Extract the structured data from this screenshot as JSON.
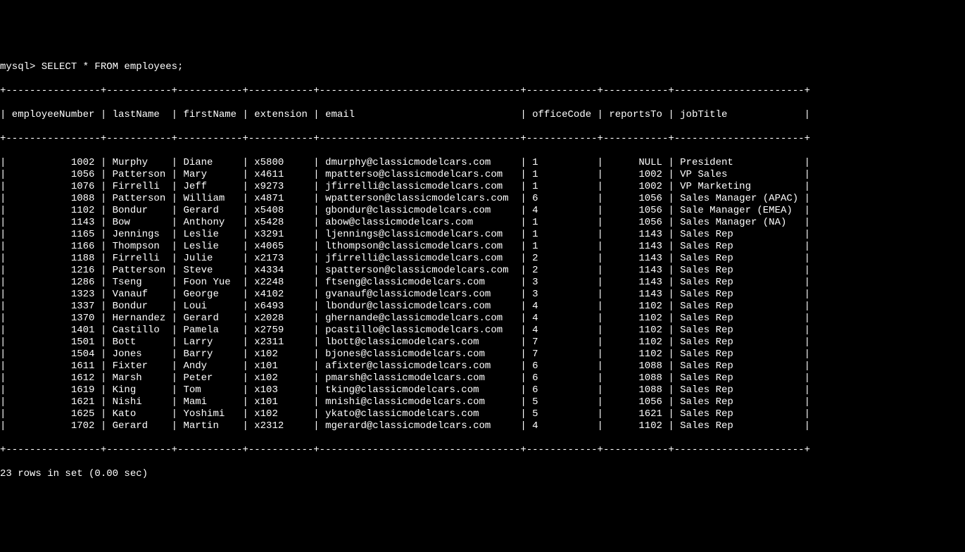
{
  "prompt": "mysql> SELECT * FROM employees;",
  "columns": [
    "employeeNumber",
    "lastName",
    "firstName",
    "extension",
    "email",
    "officeCode",
    "reportsTo",
    "jobTitle"
  ],
  "widths": [
    16,
    11,
    11,
    11,
    34,
    12,
    11,
    22
  ],
  "rightAlign": [
    true,
    false,
    false,
    false,
    false,
    false,
    true,
    false
  ],
  "rows": [
    [
      "1002",
      "Murphy",
      "Diane",
      "x5800",
      "dmurphy@classicmodelcars.com",
      "1",
      "NULL",
      "President"
    ],
    [
      "1056",
      "Patterson",
      "Mary",
      "x4611",
      "mpatterso@classicmodelcars.com",
      "1",
      "1002",
      "VP Sales"
    ],
    [
      "1076",
      "Firrelli",
      "Jeff",
      "x9273",
      "jfirrelli@classicmodelcars.com",
      "1",
      "1002",
      "VP Marketing"
    ],
    [
      "1088",
      "Patterson",
      "William",
      "x4871",
      "wpatterson@classicmodelcars.com",
      "6",
      "1056",
      "Sales Manager (APAC)"
    ],
    [
      "1102",
      "Bondur",
      "Gerard",
      "x5408",
      "gbondur@classicmodelcars.com",
      "4",
      "1056",
      "Sale Manager (EMEA)"
    ],
    [
      "1143",
      "Bow",
      "Anthony",
      "x5428",
      "abow@classicmodelcars.com",
      "1",
      "1056",
      "Sales Manager (NA)"
    ],
    [
      "1165",
      "Jennings",
      "Leslie",
      "x3291",
      "ljennings@classicmodelcars.com",
      "1",
      "1143",
      "Sales Rep"
    ],
    [
      "1166",
      "Thompson",
      "Leslie",
      "x4065",
      "lthompson@classicmodelcars.com",
      "1",
      "1143",
      "Sales Rep"
    ],
    [
      "1188",
      "Firrelli",
      "Julie",
      "x2173",
      "jfirrelli@classicmodelcars.com",
      "2",
      "1143",
      "Sales Rep"
    ],
    [
      "1216",
      "Patterson",
      "Steve",
      "x4334",
      "spatterson@classicmodelcars.com",
      "2",
      "1143",
      "Sales Rep"
    ],
    [
      "1286",
      "Tseng",
      "Foon Yue",
      "x2248",
      "ftseng@classicmodelcars.com",
      "3",
      "1143",
      "Sales Rep"
    ],
    [
      "1323",
      "Vanauf",
      "George",
      "x4102",
      "gvanauf@classicmodelcars.com",
      "3",
      "1143",
      "Sales Rep"
    ],
    [
      "1337",
      "Bondur",
      "Loui",
      "x6493",
      "lbondur@classicmodelcars.com",
      "4",
      "1102",
      "Sales Rep"
    ],
    [
      "1370",
      "Hernandez",
      "Gerard",
      "x2028",
      "ghernande@classicmodelcars.com",
      "4",
      "1102",
      "Sales Rep"
    ],
    [
      "1401",
      "Castillo",
      "Pamela",
      "x2759",
      "pcastillo@classicmodelcars.com",
      "4",
      "1102",
      "Sales Rep"
    ],
    [
      "1501",
      "Bott",
      "Larry",
      "x2311",
      "lbott@classicmodelcars.com",
      "7",
      "1102",
      "Sales Rep"
    ],
    [
      "1504",
      "Jones",
      "Barry",
      "x102",
      "bjones@classicmodelcars.com",
      "7",
      "1102",
      "Sales Rep"
    ],
    [
      "1611",
      "Fixter",
      "Andy",
      "x101",
      "afixter@classicmodelcars.com",
      "6",
      "1088",
      "Sales Rep"
    ],
    [
      "1612",
      "Marsh",
      "Peter",
      "x102",
      "pmarsh@classicmodelcars.com",
      "6",
      "1088",
      "Sales Rep"
    ],
    [
      "1619",
      "King",
      "Tom",
      "x103",
      "tking@classicmodelcars.com",
      "6",
      "1088",
      "Sales Rep"
    ],
    [
      "1621",
      "Nishi",
      "Mami",
      "x101",
      "mnishi@classicmodelcars.com",
      "5",
      "1056",
      "Sales Rep"
    ],
    [
      "1625",
      "Kato",
      "Yoshimi",
      "x102",
      "ykato@classicmodelcars.com",
      "5",
      "1621",
      "Sales Rep"
    ],
    [
      "1702",
      "Gerard",
      "Martin",
      "x2312",
      "mgerard@classicmodelcars.com",
      "4",
      "1102",
      "Sales Rep"
    ]
  ],
  "footer": "23 rows in set (0.00 sec)"
}
